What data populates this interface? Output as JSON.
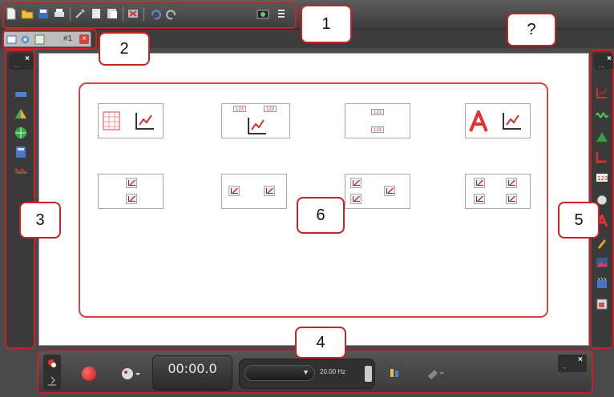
{
  "toolbar": {
    "buttons": [
      "new-icon",
      "open-folder-icon",
      "save-icon",
      "print-icon",
      "tools-icon",
      "copy-icon",
      "paste-icon",
      "remove-layout-icon",
      "undo-icon",
      "redo-icon",
      "camera-icon",
      "options-icon"
    ]
  },
  "tabs": {
    "icons": [
      "new-tab-icon",
      "gear-icon",
      "grid-icon"
    ],
    "label": "#1",
    "close": "×"
  },
  "left_panel": {
    "close": "×",
    "dots": "..",
    "icons": [
      "ruler-icon",
      "triangle-icon",
      "globe-icon",
      "calculator-icon",
      "wave-icon"
    ]
  },
  "right_panel": {
    "close": "×",
    "dots": "..",
    "icons": [
      "chart-icon",
      "sine-icon",
      "histogram-icon",
      "bar-chart-icon",
      "numeric-display-icon",
      "dial-icon",
      "text-icon",
      "pencil-icon",
      "image-icon",
      "video-icon",
      "snapshot-icon"
    ]
  },
  "bottom_bar": {
    "time": "00:00.0",
    "sample_rate": "20.00 Hz",
    "close": "×",
    "dots": ".."
  },
  "callouts": [
    "1",
    "2",
    "3",
    "4",
    "5",
    "6",
    "?"
  ],
  "colors": {
    "accent_red": "#c42424",
    "frame_gray": "#4a4a4a"
  }
}
